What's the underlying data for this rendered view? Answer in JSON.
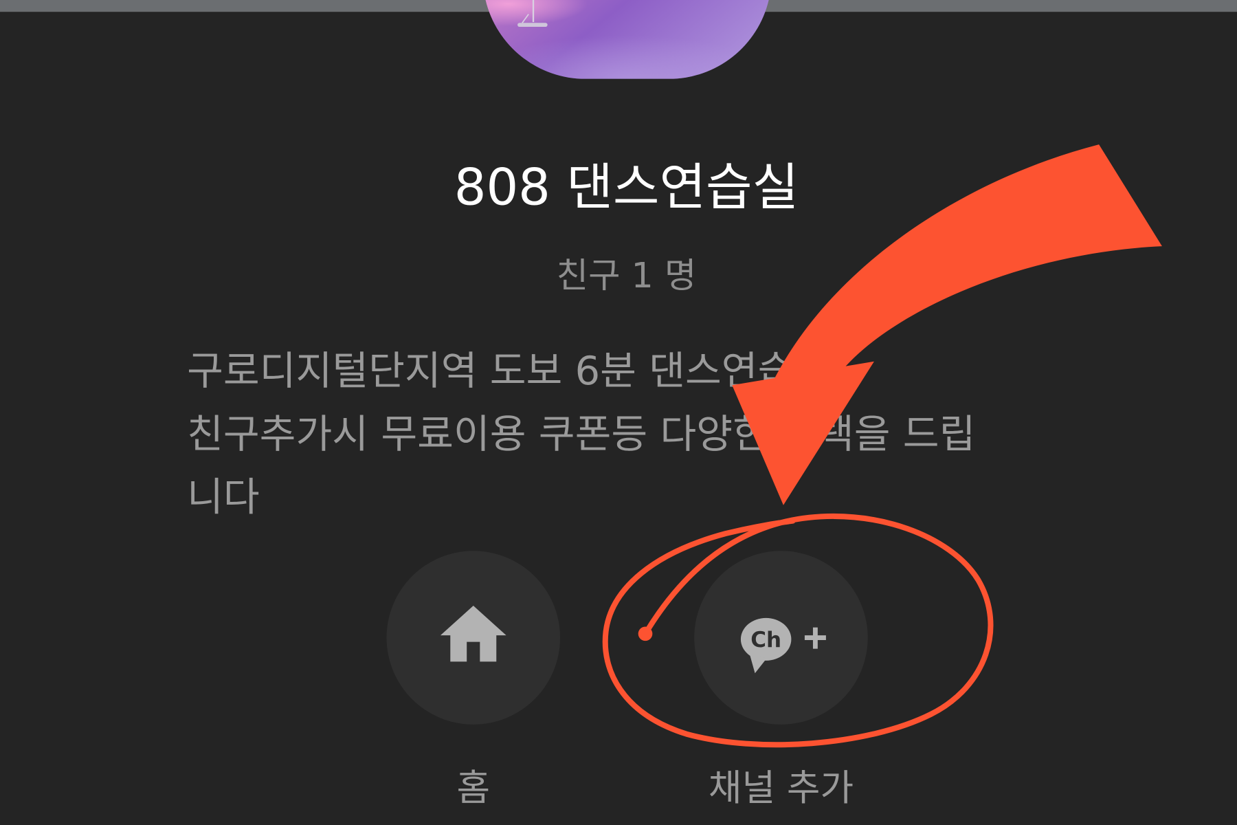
{
  "profile": {
    "name": "808 댄스연습실",
    "friends_label": "친구 1 명",
    "description_lines": [
      "구로디지털단지역 도보 6분 댄스연습실!",
      "친구추가시 무료이용 쿠폰등 다양한 혜택을 드립",
      "니다"
    ]
  },
  "actions": [
    {
      "label": "홈",
      "icon": "home-icon"
    },
    {
      "label": "채널 추가",
      "icon": "channel-add-icon",
      "icon_text": "Ch"
    }
  ],
  "colors": {
    "background": "#242424",
    "top_bar": "#6b6e71",
    "title": "#ffffff",
    "secondary_text": "#8e8e8e",
    "description_text": "#9a9a9a",
    "action_circle": "#2f2f2f",
    "icon": "#b3b3b3",
    "annotation": "#fd5331"
  }
}
